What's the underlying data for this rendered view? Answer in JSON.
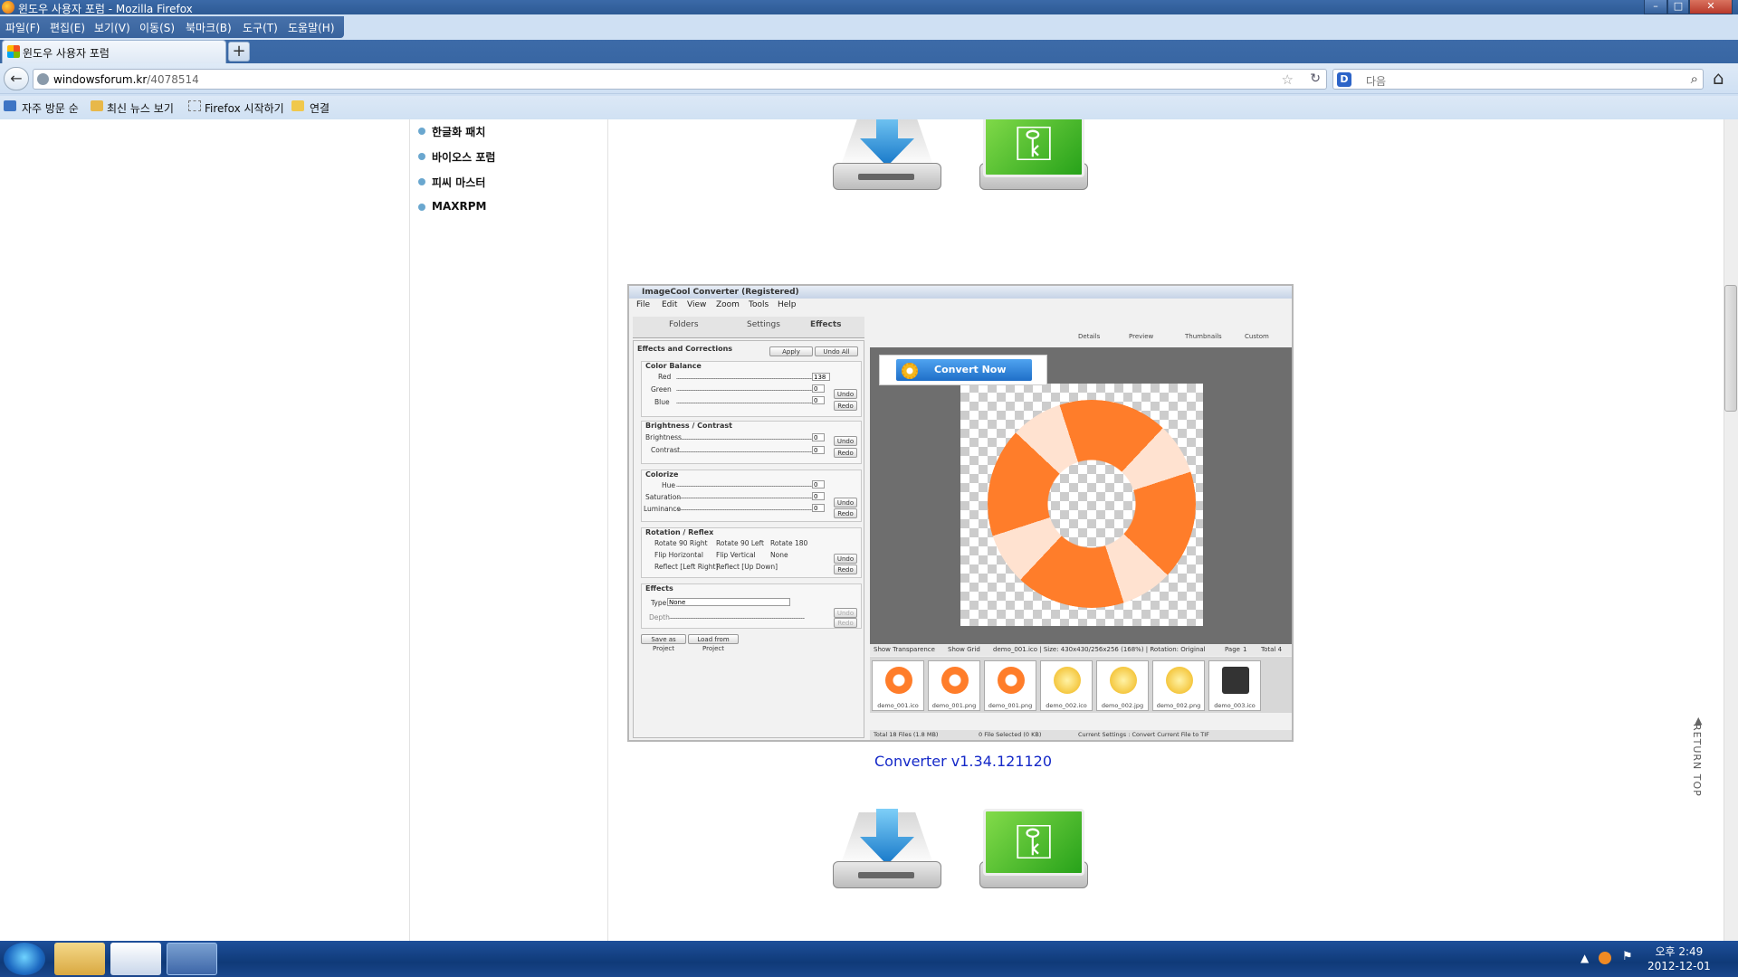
{
  "window": {
    "title": "윈도우 사용자 포럼 - Mozilla Firefox",
    "min": "–",
    "max": "□",
    "close": "✕"
  },
  "menu": [
    "파일(F)",
    "편집(E)",
    "보기(V)",
    "이동(S)",
    "북마크(B)",
    "도구(T)",
    "도움말(H)"
  ],
  "tab": {
    "title": "윈도우 사용자 포럼",
    "new_tab": "+"
  },
  "nav": {
    "back": "←",
    "url_host": "windowsforum.kr",
    "url_path": "/4078514",
    "search_placeholder": "다음",
    "home": "⌂"
  },
  "bookmarks": [
    "자주 방문 순",
    "최신 뉴스 보기",
    "Firefox 시작하기",
    "연결"
  ],
  "sidebar_links": [
    "한글화 패치",
    "바이오스 포럼",
    "피씨 마스터",
    "MAXRPM"
  ],
  "app": {
    "title": "ImageCool Converter  (Registered)",
    "menu": [
      "File",
      "Edit",
      "View",
      "Zoom",
      "Tools",
      "Help"
    ],
    "tabs": [
      "Folders",
      "Settings",
      "Effects"
    ],
    "view_tabs": [
      "Details",
      "Preview",
      "Thumbnails",
      "Custom"
    ],
    "panel_title": "Effects and Corrections",
    "apply": "Apply",
    "undo_all": "Undo All",
    "color_balance": "Color Balance",
    "red": "Red",
    "red_val": "138",
    "green": "Green",
    "green_val": "0",
    "blue": "Blue",
    "blue_val": "0",
    "undo": "Undo",
    "redo": "Redo",
    "brightness_contrast": "Brightness / Contrast",
    "brightness": "Brightness",
    "brightness_val": "0",
    "contrast": "Contrast",
    "contrast_val": "0",
    "colorize": "Colorize",
    "hue": "Hue",
    "hue_val": "0",
    "saturation": "Saturation",
    "saturation_val": "0",
    "luminance": "Luminance",
    "luminance_val": "0",
    "rotation_reflex": "Rotation / Reflex",
    "rot90r": "Rotate 90 Right",
    "rot90l": "Rotate 90 Left",
    "rot180": "Rotate 180",
    "fliph": "Flip Horizontal",
    "flipv": "Flip Vertical",
    "none": "None",
    "reflect_lr": "Reflect [Left Right]",
    "reflect_ud": "Reflect [Up Down]",
    "effects": "Effects",
    "type": "Type",
    "type_val": "None",
    "depth": "Depth",
    "save_project": "Save as Project",
    "load_project": "Load from Project",
    "convert_now": "Convert Now",
    "show_transparence": "Show Transparence",
    "show_grid": "Show Grid",
    "status_info": "demo_001.ico  |  Size: 430x430/256x256 (168%)  |  Rotation: Original",
    "page": "Page",
    "page_val": "1",
    "total": "Total 4",
    "thumbs": [
      "demo_001.ico",
      "demo_001.png",
      "demo_001.png",
      "demo_002.ico",
      "demo_002.jpg",
      "demo_002.png",
      "demo_003.ico"
    ],
    "footer_total": "Total 18 Files (1.8 MB)",
    "footer_selected": "0 File Selected (0 KB)",
    "footer_settings": "Current Settings : Convert Current File to TIF"
  },
  "caption": "Converter v1.34.121120",
  "return_top": "RETURN TOP",
  "clock": {
    "time": "오후 2:49",
    "date": "2012-12-01"
  }
}
